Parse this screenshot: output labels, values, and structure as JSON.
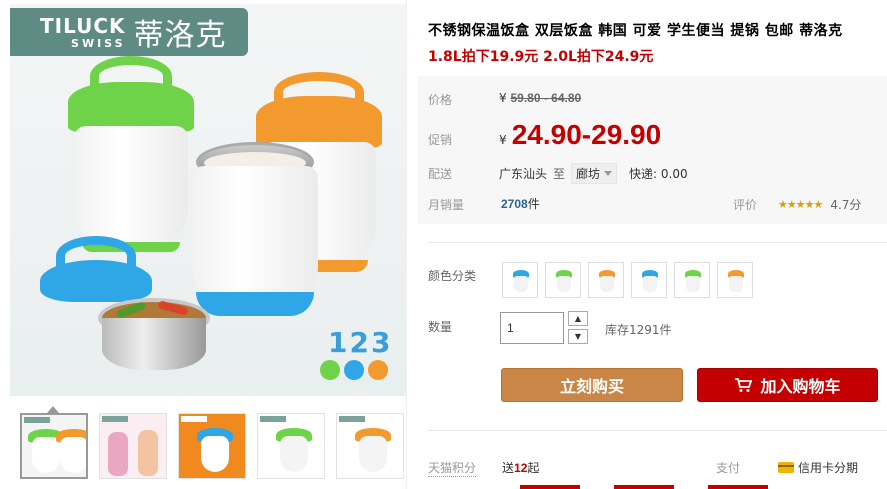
{
  "brand": {
    "name_en": "TILUCK",
    "sub_en": "SWISS",
    "name_cn": "蒂洛克"
  },
  "gallery": {
    "numbers_badge": "123",
    "dot_colors": [
      "#6fd34a",
      "#2fa7e6",
      "#f29a2e"
    ],
    "thumbnails": [
      {
        "label": "thumb-1",
        "lid_color": "#2fa7e6"
      },
      {
        "label": "thumb-2",
        "lid_color": "#e9a7c1"
      },
      {
        "label": "thumb-3",
        "lid_color": "#2fa7e6"
      },
      {
        "label": "thumb-4",
        "lid_color": "#6fd34a"
      },
      {
        "label": "thumb-5",
        "lid_color": "#f29a2e"
      }
    ]
  },
  "product": {
    "title": "不锈钢保温饭盒 双层饭盒 韩国 可爱 学生便当 提锅 包邮 蒂洛克",
    "subtitle": "1.8L拍下19.9元 2.0L拍下24.9元"
  },
  "pricing": {
    "price_label": "价格",
    "currency": "¥",
    "original_price": "59.80 - 64.80",
    "promo_label": "促销",
    "promo_price": "24.90-29.90"
  },
  "shipping": {
    "label": "配送",
    "from": "广东汕头",
    "to_word": "至",
    "destination": "廊坊",
    "courier": "快递: 0.00"
  },
  "sales": {
    "label": "月销量",
    "count": "2708",
    "unit": "件",
    "rating_label": "评价",
    "stars": "★★★★★",
    "score": "4.7分"
  },
  "options": {
    "color_label": "颜色分类",
    "swatches": [
      "#2fa7e6",
      "#6fd34a",
      "#f29a2e",
      "#2fa7e6",
      "#6fd34a",
      "#f29a2e"
    ]
  },
  "quantity": {
    "label": "数量",
    "value": "1",
    "stock": "库存1291件"
  },
  "actions": {
    "buy_now": "立刻购买",
    "add_to_cart": "加入购物车"
  },
  "footer": {
    "points_label": "天猫积分",
    "points_prefix": "送",
    "points_value": "12",
    "points_suffix": "起",
    "pay_label": "支付",
    "credit": "信用卡分期"
  },
  "colors": {
    "brand_teal": "#5e8b83",
    "price_red": "#c40000",
    "buy_orange": "#c98646",
    "cart_red": "#c40000"
  }
}
